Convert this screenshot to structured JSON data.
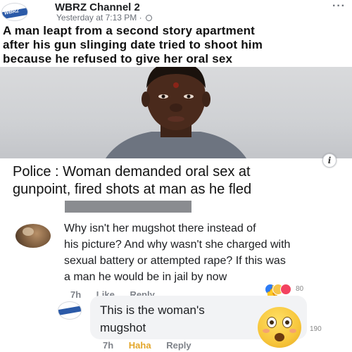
{
  "post": {
    "page_name": "WBRZ Channel 2",
    "timestamp": "Yesterday at 7:13 PM ·",
    "avatar_text": "WBRZ",
    "headline_lines": [
      "A man leapt from a second story apartment",
      "after his gun slinging date tried to shoot him",
      "because he refused to give her oral sex"
    ]
  },
  "link": {
    "caption_lines": [
      "Police : Woman demanded oral sex at",
      "gunpoint, fired shots at man as he fled"
    ],
    "info_label": "i"
  },
  "comments": [
    {
      "lines": [
        "Why isn't her mugshot there instead of",
        "his picture? And why wasn't she charged with",
        "sexual battery or attempted rape? If this was",
        "a man he would be in jail by now"
      ],
      "time": "7h",
      "like": "Like",
      "reply": "Reply",
      "reaction_count": "80"
    },
    {
      "lines": [
        "This is the woman's",
        "mugshot"
      ],
      "time": "7h",
      "reaction": "Haha",
      "reply": "Reply",
      "reaction_count": "190"
    }
  ],
  "icons": {
    "more": "more-options-icon",
    "globe": "globe-icon",
    "info": "info-icon"
  },
  "colors": {
    "brand_blue": "#2b5aa8",
    "meta_text": "#7f838a",
    "haha_yellow": "#e3a62a"
  }
}
